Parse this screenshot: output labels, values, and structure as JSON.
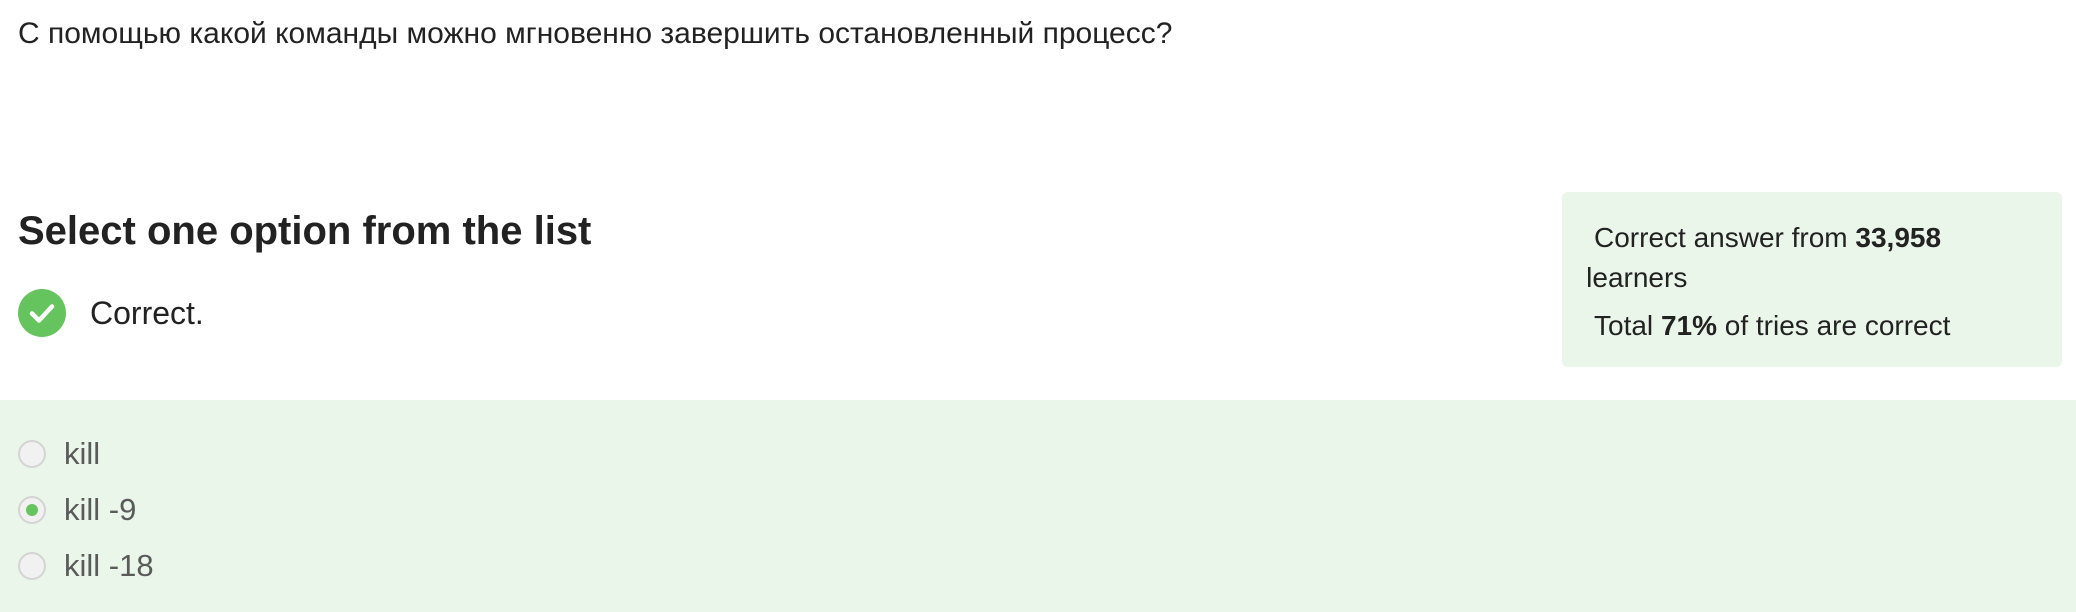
{
  "question": {
    "text": "С помощью какой команды можно мгновенно завершить остановленный процесс?"
  },
  "quiz": {
    "heading": "Select one option from the list",
    "result_label": "Correct.",
    "result_icon": "checkmark-icon",
    "result_color": "#66c45e"
  },
  "stats": {
    "prefix": "Correct answer from ",
    "learners_count": "33,958",
    "learners_suffix": " learners",
    "total_prefix": "Total ",
    "percent": "71%",
    "total_suffix": " of tries are correct",
    "background": "#ebf6ea"
  },
  "options": [
    {
      "label": "kill",
      "selected": false
    },
    {
      "label": "kill -9",
      "selected": true
    },
    {
      "label": "kill -18",
      "selected": false
    }
  ]
}
